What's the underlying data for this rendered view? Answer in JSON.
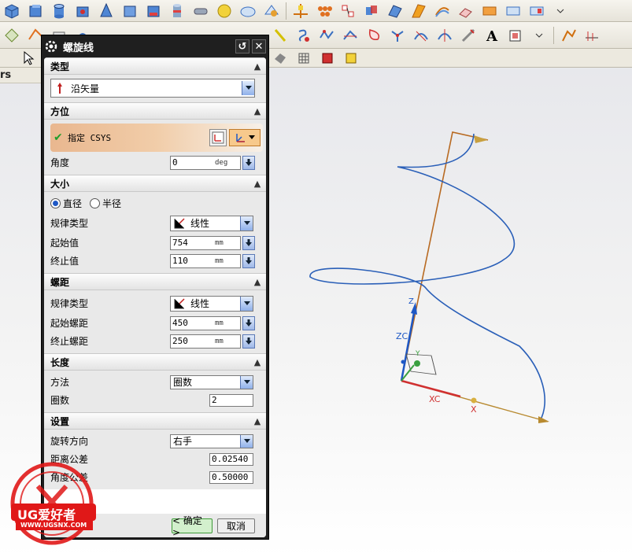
{
  "left_label": "rs",
  "toolbar": {
    "icons": [
      "box-icon",
      "cylinder-icon",
      "cone-icon",
      "sphere-icon",
      "extrude-icon",
      "revolve-icon",
      "hole-icon",
      "boss-icon",
      "pocket-icon",
      "pad-icon",
      "slot-icon",
      "groove-icon",
      "blend-icon",
      "chamfer-icon",
      "shell-icon",
      "face-icon",
      "trim-icon",
      "curve-icon",
      "spline-icon",
      "text-icon"
    ],
    "text_icon_glyph": "A"
  },
  "dialog": {
    "title": "螺旋线",
    "sections": {
      "type": {
        "header": "类型",
        "value": "沿矢量"
      },
      "orientation": {
        "header": "方位",
        "csys_label": "指定 CSYS",
        "angle_label": "角度",
        "angle_value": "0",
        "angle_unit": "deg"
      },
      "size": {
        "header": "大小",
        "radio_diameter": "直径",
        "radio_radius": "半径",
        "selected": "diameter",
        "law_label": "规律类型",
        "law_value": "线性",
        "start_label": "起始值",
        "start_value": "754",
        "start_unit": "mm",
        "end_label": "终止值",
        "end_value": "110",
        "end_unit": "mm"
      },
      "pitch": {
        "header": "螺距",
        "law_label": "规律类型",
        "law_value": "线性",
        "start_label": "起始螺距",
        "start_value": "450",
        "start_unit": "mm",
        "end_label": "终止螺距",
        "end_value": "250",
        "end_unit": "mm"
      },
      "length": {
        "header": "长度",
        "method_label": "方法",
        "method_value": "圈数",
        "turns_label": "圈数",
        "turns_value": "2"
      },
      "settings": {
        "header": "设置",
        "rotation_label": "旋转方向",
        "rotation_value": "右手",
        "dist_tol_label": "距离公差",
        "dist_tol_value": "0.02540",
        "angle_tol_label": "角度公差",
        "angle_tol_value": "0.50000"
      }
    },
    "ok_label": "< 确定 >",
    "cancel_label": "取消"
  },
  "viewport": {
    "axis_zc": "ZC",
    "axis_xc": "XC",
    "axis_x": "X",
    "axis_z": "Z",
    "axis_y": "Y"
  },
  "watermark": {
    "brand": "UG爱好者",
    "url": "WWW.UGSNX.COM"
  }
}
